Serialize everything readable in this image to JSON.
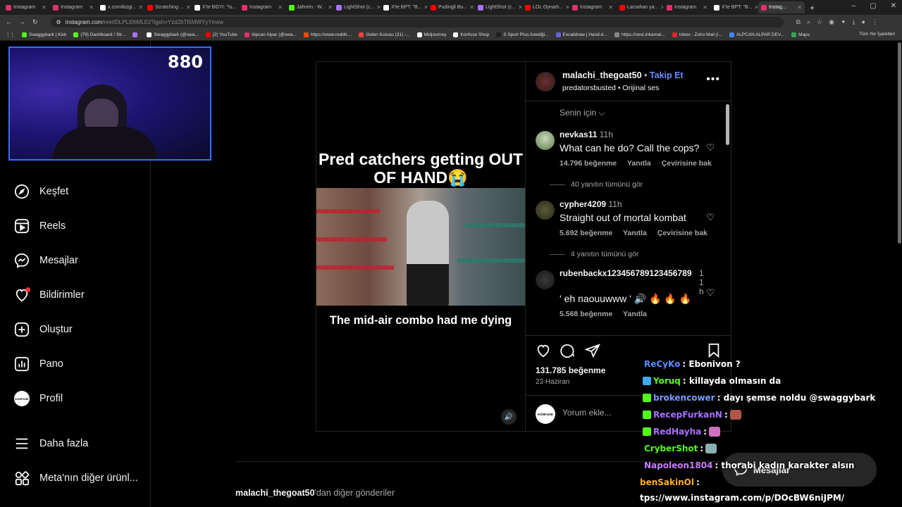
{
  "browser": {
    "tabs": [
      {
        "label": "Instagram",
        "color": "#e1306c"
      },
      {
        "label": "Instagram",
        "color": "#e1306c"
      },
      {
        "label": "x.com/kizgi...",
        "color": "#ffffff"
      },
      {
        "label": "Scratching ...",
        "color": "#ff0000"
      },
      {
        "label": "X'te BGYI: \"Is...",
        "color": "#ffffff"
      },
      {
        "label": "Instagram",
        "color": "#e1306c"
      },
      {
        "label": "Jahrein - W...",
        "color": "#53fc18"
      },
      {
        "label": "LightShot (c...",
        "color": "#a970ff"
      },
      {
        "label": "X'te BPT: \"B...",
        "color": "#ffffff"
      },
      {
        "label": "Pudingli Bu...",
        "color": "#ff0000"
      },
      {
        "label": "LightShot (c...",
        "color": "#a970ff"
      },
      {
        "label": "LOL Oynarlı...",
        "color": "#ff0000"
      },
      {
        "label": "Instagram",
        "color": "#e1306c"
      },
      {
        "label": "Larsahan ya...",
        "color": "#ff0000"
      },
      {
        "label": "Instagram",
        "color": "#e1306c"
      },
      {
        "label": "X'te BPT: \"B...",
        "color": "#ffffff"
      },
      {
        "label": "Instag...",
        "color": "#e1306c",
        "active": true
      }
    ],
    "new_tab": "+",
    "url_host": "instagram.com",
    "url_path": "/reel/DLPLl0hMLEi/?igsh=Yzd2bTl5MWYyYmsw",
    "bookmarks": [
      {
        "label": "Swaggybark | Kick",
        "color": "#53fc18"
      },
      {
        "label": "(79) Dashboard / Str...",
        "color": "#53fc18"
      },
      {
        "label": "",
        "color": "#a970ff"
      },
      {
        "label": "Swaggybark (@swa...",
        "color": "#ffffff"
      },
      {
        "label": "(2) YouTube",
        "color": "#ff0000"
      },
      {
        "label": "Alpcan Alpar (@swa...",
        "color": "#e1306c"
      },
      {
        "label": "https://www.reddit....",
        "color": "#ff4500"
      },
      {
        "label": "Gelen Kutusu (31) -...",
        "color": "#ea4335"
      },
      {
        "label": "Midjourney",
        "color": "#ffffff"
      },
      {
        "label": "Konfuse Shop",
        "color": "#ffffff"
      },
      {
        "label": "S Sport Plus-İstediği...",
        "color": "#1f1f1f"
      },
      {
        "label": "Excalidraw | Hand-d...",
        "color": "#6965db"
      },
      {
        "label": "https://next.inkamat...",
        "color": "#888888"
      },
      {
        "label": "Inbox - Zoho Mail (i...",
        "color": "#e42527"
      },
      {
        "label": "ALPCAN ALPAR DEV...",
        "color": "#4285f4"
      },
      {
        "label": "Maps",
        "color": "#34a853"
      }
    ],
    "bookmarks_right": "Tüm Yer İşaretleri"
  },
  "webcam": {
    "viewer_count": "880"
  },
  "sidebar": {
    "items": [
      {
        "label": "Keşfet",
        "icon": "compass-icon"
      },
      {
        "label": "Reels",
        "icon": "reels-icon"
      },
      {
        "label": "Mesajlar",
        "icon": "messenger-icon"
      },
      {
        "label": "Bildirimler",
        "icon": "heart-icon"
      },
      {
        "label": "Oluştur",
        "icon": "plus-square-icon"
      },
      {
        "label": "Pano",
        "icon": "dashboard-icon"
      },
      {
        "label": "Profil",
        "icon": "profile-avatar"
      },
      {
        "label": "Daha fazla",
        "icon": "menu-icon"
      },
      {
        "label": "Meta'nın diğer ürünl...",
        "icon": "meta-apps-icon"
      }
    ],
    "profile_avatar_text": "KONFUSE"
  },
  "post": {
    "video": {
      "title": "Pred catchers getting OUT OF HAND😭",
      "caption": "The mid-air combo had me dying",
      "mute_icon": "🔊"
    },
    "header": {
      "username": "malachi_thegoat50",
      "follow": "Takip Et",
      "subtitle_user": "predatorsbusted",
      "subtitle_audio": "Orijinal ses"
    },
    "sort_label": "Senin için",
    "comments": [
      {
        "user": "nevkas11",
        "time": "11h",
        "text": "What can he do? Call the cops?",
        "likes": "14.796 beğenme",
        "reply": "Yanıtla",
        "translate": "Çevirisine bak",
        "replies": "40 yanıtın tümünü gör"
      },
      {
        "user": "cypher4209",
        "time": "11h",
        "text": "Straight out of mortal kombat",
        "likes": "5.692 beğenme",
        "reply": "Yanıtla",
        "translate": "Çevirisine bak",
        "replies": "4 yanıtın tümünü gör"
      },
      {
        "user": "rubenbackx123456789123456789",
        "time": "11h",
        "text": "' eh naouuwww ' 🔊 🔥 🔥 🔥",
        "likes": "5.568 beğenme",
        "reply": "Yanıtla",
        "translate": "",
        "replies": ""
      }
    ],
    "like_count": "131.785 beğenme",
    "date": "23 Haziran",
    "comment_placeholder": "Yorum ekle...",
    "comment_avatar_text": "KONFUSE"
  },
  "more_posts": {
    "user": "malachi_thegoat50",
    "suffix": "'dan diğer gönderiler"
  },
  "messages_button": "Mesajlar",
  "chat": [
    {
      "user": "ReCyKo",
      "color": "#5b8cff",
      "msg": ": Ebonivon ?",
      "badge": ""
    },
    {
      "user": "Yoruq",
      "color": "#53fc18",
      "msg": ": killayda olmasın da",
      "badge": "#3fa9f5"
    },
    {
      "user": "brokencower",
      "color": "#7b9bff",
      "msg": ": dayı şemse noldu @swaggybark",
      "badge": "#53fc18"
    },
    {
      "user": "RecepFurkanN",
      "color": "#a970ff",
      "msg": ":",
      "badge": "#53fc18"
    },
    {
      "user": "RedHayha",
      "color": "#a970ff",
      "msg": ":",
      "badge": "#53fc18"
    },
    {
      "user": "CryberShot",
      "color": "#53fc18",
      "msg": ":",
      "badge": ""
    },
    {
      "user": "Napoleon1804",
      "color": "#c77dff",
      "msg": ": thorabi kadın karakter alsın",
      "badge": ""
    },
    {
      "user": "benSakinOl",
      "color": "#ffb020",
      "msg": ":",
      "badge": ""
    },
    {
      "user": "",
      "color": "#ffffff",
      "msg": "tps://www.instagram.com/p/DOcBW6niJPM/",
      "badge": ""
    }
  ]
}
